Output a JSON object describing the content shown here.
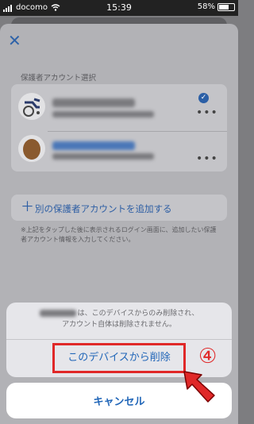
{
  "status_bar": {
    "carrier": "docomo",
    "time": "15:39",
    "battery": "58%"
  },
  "sheet": {
    "section_title": "保護者アカウント選択",
    "add_account_label": "別の保護者アカウントを追加する",
    "note": "※上記をタップした後に表示されるログイン画面に、追加したい保護者アカウント情報を入力してください。",
    "more_icon": "•••"
  },
  "action_sheet": {
    "message_line1": "は、このデバイスからのみ削除され、",
    "message_line2": "アカウント自体は削除されません。",
    "delete_label": "このデバイスから削除",
    "cancel_label": "キャンセル"
  },
  "annotation": {
    "step_number": "④",
    "color": "#e02828"
  },
  "colors": {
    "accent": "#2166b8",
    "danger_outline": "#e02828"
  }
}
